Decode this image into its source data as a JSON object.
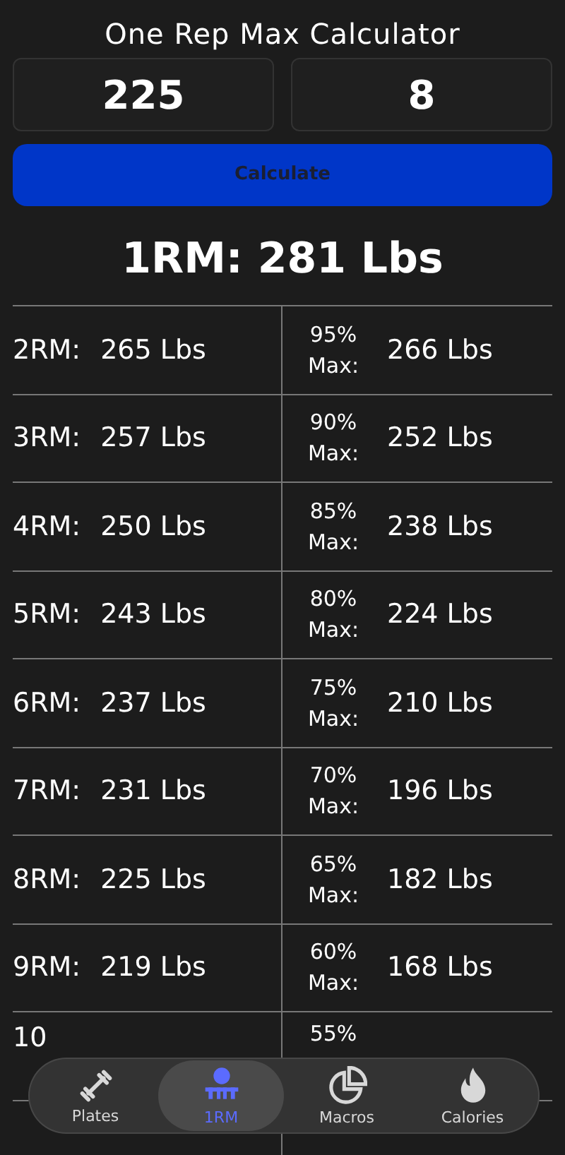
{
  "title": "One Rep Max Calculator",
  "inputs": [
    {
      "value": "225"
    },
    {
      "value": "8"
    }
  ],
  "calculate_button": "Calculate",
  "result": "1RM: 281 Lbs",
  "rows": [
    {
      "rm_label": "2RM:",
      "rm_value": "265 Lbs",
      "percent": "95%",
      "max_label": "Max:",
      "max_value": "266 Lbs"
    },
    {
      "rm_label": "3RM:",
      "rm_value": "257 Lbs",
      "percent": "90%",
      "max_label": "Max:",
      "max_value": "252 Lbs"
    },
    {
      "rm_label": "4RM:",
      "rm_value": "250 Lbs",
      "percent": "85%",
      "max_label": "Max:",
      "max_value": "238 Lbs"
    },
    {
      "rm_label": "5RM:",
      "rm_value": "243 Lbs",
      "percent": "80%",
      "max_label": "Max:",
      "max_value": "224 Lbs"
    },
    {
      "rm_label": "6RM:",
      "rm_value": "237 Lbs",
      "percent": "75%",
      "max_label": "Max:",
      "max_value": "210 Lbs"
    },
    {
      "rm_label": "7RM:",
      "rm_value": "231 Lbs",
      "percent": "70%",
      "max_label": "Max:",
      "max_value": "196 Lbs"
    },
    {
      "rm_label": "8RM:",
      "rm_value": "225 Lbs",
      "percent": "65%",
      "max_label": "Max:",
      "max_value": "182 Lbs"
    },
    {
      "rm_label": "9RM:",
      "rm_value": "219 Lbs",
      "percent": "60%",
      "max_label": "Max:",
      "max_value": "168 Lbs"
    },
    {
      "rm_label": "10",
      "percent": "55%"
    },
    {}
  ],
  "tab_bar": [
    {
      "kind": "plates",
      "label": "Plates",
      "selected": false
    },
    {
      "kind": "onerm",
      "label": "1RM",
      "selected": true
    },
    {
      "kind": "macros",
      "label": "Macros",
      "selected": false
    },
    {
      "kind": "calories",
      "label": "Calories",
      "selected": false
    }
  ]
}
